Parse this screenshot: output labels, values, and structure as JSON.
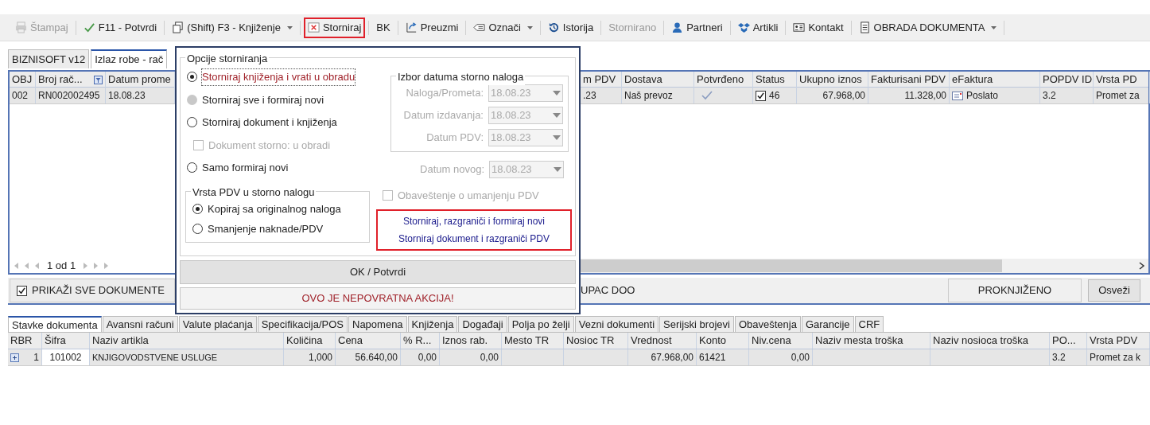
{
  "toolbar": [
    {
      "kind": "print",
      "label": "Štampaj",
      "disabled": true,
      "caret": false,
      "highlighted": false
    },
    {
      "kind": "check",
      "label": "F11 - Potvrdi",
      "disabled": false,
      "caret": false,
      "highlighted": false
    },
    {
      "kind": "copy",
      "label": "(Shift) F3 - Knjiženje",
      "disabled": false,
      "caret": true,
      "highlighted": false
    },
    {
      "kind": "cancel",
      "label": "Storniraj",
      "disabled": false,
      "caret": false,
      "highlighted": true
    },
    {
      "kind": "text",
      "label": "BK",
      "disabled": false,
      "caret": false,
      "highlighted": false
    },
    {
      "kind": "import",
      "label": "Preuzmi",
      "disabled": false,
      "caret": false,
      "highlighted": false
    },
    {
      "kind": "tag",
      "label": "Označi",
      "disabled": false,
      "caret": true,
      "highlighted": false
    },
    {
      "kind": "history",
      "label": "Istorija",
      "disabled": false,
      "caret": false,
      "highlighted": false
    },
    {
      "kind": "text",
      "label": "Stornirano",
      "disabled": true,
      "caret": false,
      "highlighted": false
    },
    {
      "kind": "user",
      "label": "Partneri",
      "disabled": false,
      "caret": false,
      "highlighted": false
    },
    {
      "kind": "box",
      "label": "Artikli",
      "disabled": false,
      "caret": false,
      "highlighted": false
    },
    {
      "kind": "card",
      "label": "Kontakt",
      "disabled": false,
      "caret": false,
      "highlighted": false
    },
    {
      "kind": "doc",
      "label": "OBRADA DOKUMENTA",
      "disabled": false,
      "caret": true,
      "highlighted": false
    }
  ],
  "tabs": [
    {
      "label": "BIZNISOFT v12",
      "selected": false
    },
    {
      "label": "Izlaz robe - rač",
      "selected": true
    }
  ],
  "documents": {
    "left_columns": [
      "OBJ",
      "Broj rač...",
      "Datum prome"
    ],
    "right_columns": [
      "m PDV",
      "Dostava",
      "Potvrđeno",
      "Status",
      "Ukupno iznos",
      "Fakturisani PDV",
      "eFaktura",
      "POPDV ID",
      "Vrsta PD"
    ],
    "rows": [
      {
        "obj": "002",
        "number": "RN002002495",
        "date": "18.08.23",
        "pdv_date": ".23",
        "delivery": "Naš prevoz",
        "confirmed": true,
        "status_checked": true,
        "status": "46",
        "total": "67.968,00",
        "vat": "11.328,00",
        "efaktura": "Poslato",
        "popdv": "3.2",
        "vat_type": "Promet za"
      }
    ],
    "pager": "1 od 1"
  },
  "bottom_bar": {
    "show_all": {
      "label": "PRIKAŽI SVE DOKUMENTE",
      "checked": true
    },
    "partner": "UPAC DOO",
    "status": "PROKNJIŽENO",
    "refresh": "Osveži"
  },
  "dialog": {
    "options_title": "Opcije storniranja",
    "options": [
      {
        "kind": "radio",
        "label": "Storniraj knjiženja i vrati u obradu",
        "selected": true,
        "disabled": false
      },
      {
        "kind": "radio",
        "label": "Storniraj sve i formiraj novi",
        "selected": false,
        "disabled": true
      },
      {
        "kind": "radio",
        "label": "Storniraj dokument i knjiženja",
        "selected": false,
        "disabled": false
      },
      {
        "kind": "checkbox",
        "label": "Dokument storno: u obradi",
        "selected": false,
        "disabled": true
      },
      {
        "kind": "radio",
        "label": "Samo formiraj novi",
        "selected": false,
        "disabled": false
      }
    ],
    "vat_title": "Vrsta PDV u storno nalogu",
    "vat_options": [
      {
        "label": "Kopiraj sa originalnog naloga",
        "selected": true
      },
      {
        "label": "Smanjenje naknade/PDV",
        "selected": false
      }
    ],
    "dates_title": "Izbor datuma storno naloga",
    "dates": [
      {
        "label": "Naloga/Prometa:",
        "value": "18.08.23"
      },
      {
        "label": "Datum izdavanja:",
        "value": "18.08.23"
      },
      {
        "label": "Datum PDV:",
        "value": "18.08.23"
      }
    ],
    "new_date": {
      "label": "Datum novog:",
      "value": "18.08.23"
    },
    "notice": {
      "label": "Obaveštenje o umanjenju PDV",
      "checked": false
    },
    "links": [
      "Storniraj, razgraniči i formiraj novi",
      "Storniraj dokument i razgraniči PDV"
    ],
    "links_highlighted": true,
    "ok": "OK / Potvrdi",
    "warning": "OVO JE NEPOVRATNA AKCIJA!"
  },
  "detail_tabs": [
    {
      "label": "Stavke dokumenta",
      "selected": true
    },
    {
      "label": "Avansni računi",
      "selected": false
    },
    {
      "label": "Valute plaćanja",
      "selected": false
    },
    {
      "label": "Specifikacija/POS",
      "selected": false
    },
    {
      "label": "Napomena",
      "selected": false
    },
    {
      "label": "Knjiženja",
      "selected": false
    },
    {
      "label": "Događaji",
      "selected": false
    },
    {
      "label": "Polja po želji",
      "selected": false
    },
    {
      "label": "Vezni dokumenti",
      "selected": false
    },
    {
      "label": "Serijski brojevi",
      "selected": false
    },
    {
      "label": "Obaveštenja",
      "selected": false
    },
    {
      "label": "Garancije",
      "selected": false
    },
    {
      "label": "CRF",
      "selected": false
    }
  ],
  "items": {
    "columns": [
      "RBR",
      "Šifra",
      "Naziv artikla",
      "Količina",
      "Cena",
      "% R...",
      "Iznos rab.",
      "Mesto TR",
      "Nosioc TR",
      "Vrednost",
      "Konto",
      "Niv.cena",
      "Naziv mesta troška",
      "Naziv nosioca troška",
      "PO...",
      "Vrsta PDV"
    ],
    "rows": [
      [
        "1",
        "101002",
        "KNJIGOVODSTVENE USLUGE",
        "1,000",
        "56.640,00",
        "0,00",
        "0,00",
        "",
        "",
        "67.968,00",
        "61421",
        "0,00",
        "",
        "",
        "3.2",
        "Promet za k"
      ]
    ]
  }
}
